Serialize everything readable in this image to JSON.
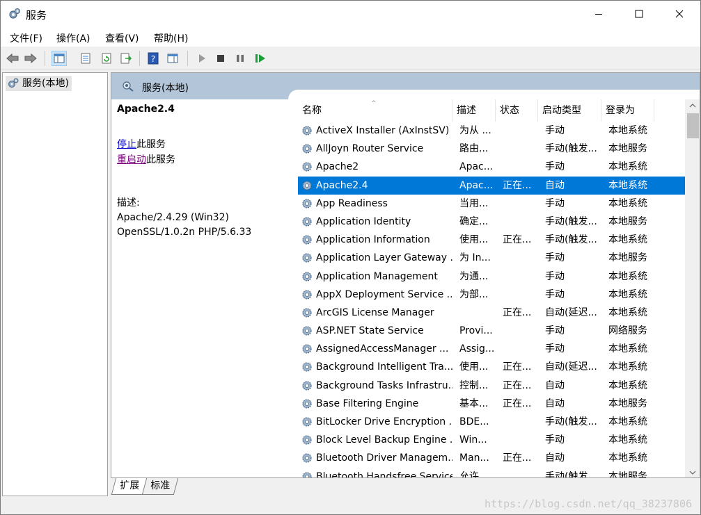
{
  "window": {
    "title": "服务",
    "app_icon": "gears-icon",
    "controls": [
      "minimize",
      "maximize",
      "close"
    ]
  },
  "menu": [
    "文件(F)",
    "操作(A)",
    "查看(V)",
    "帮助(H)"
  ],
  "toolbar": {
    "buttons": [
      "back",
      "forward",
      "show-hide-console-tree",
      "properties",
      "refresh",
      "export-list",
      "help",
      "show-action-pane",
      "start-service",
      "stop-service",
      "pause-service",
      "resume-service"
    ]
  },
  "tree": {
    "items": [
      {
        "label": "服务(本地)",
        "icon": "gears-icon"
      }
    ]
  },
  "pane": {
    "header": "服务(本地)",
    "extended": {
      "service_name": "Apache2.4",
      "stop_link": "停止",
      "stop_suffix": "此服务",
      "restart_link": "重启动",
      "restart_suffix": "此服务",
      "description_label": "描述:",
      "description_text": "Apache/2.4.29 (Win32) OpenSSL/1.0.2n PHP/5.6.33"
    },
    "columns": [
      "名称",
      "描述",
      "状态",
      "启动类型",
      "登录为"
    ],
    "rows": [
      {
        "name": "ActiveX Installer (AxInstSV)",
        "desc": "为从 ...",
        "status": "",
        "start": "手动",
        "logon": "本地系统"
      },
      {
        "name": "AllJoyn Router Service",
        "desc": "路由...",
        "status": "",
        "start": "手动(触发...",
        "logon": "本地服务"
      },
      {
        "name": "Apache2",
        "desc": "Apac...",
        "status": "",
        "start": "手动",
        "logon": "本地系统"
      },
      {
        "name": "Apache2.4",
        "desc": "Apac...",
        "status": "正在...",
        "start": "自动",
        "logon": "本地系统",
        "selected": true
      },
      {
        "name": "App Readiness",
        "desc": "当用...",
        "status": "",
        "start": "手动",
        "logon": "本地系统"
      },
      {
        "name": "Application Identity",
        "desc": "确定...",
        "status": "",
        "start": "手动(触发...",
        "logon": "本地服务"
      },
      {
        "name": "Application Information",
        "desc": "使用...",
        "status": "正在...",
        "start": "手动(触发...",
        "logon": "本地系统"
      },
      {
        "name": "Application Layer Gateway ...",
        "desc": "为 In...",
        "status": "",
        "start": "手动",
        "logon": "本地服务"
      },
      {
        "name": "Application Management",
        "desc": "为通...",
        "status": "",
        "start": "手动",
        "logon": "本地系统"
      },
      {
        "name": "AppX Deployment Service ...",
        "desc": "为部...",
        "status": "",
        "start": "手动",
        "logon": "本地系统"
      },
      {
        "name": "ArcGIS License Manager",
        "desc": "",
        "status": "正在...",
        "start": "自动(延迟...",
        "logon": "本地系统"
      },
      {
        "name": "ASP.NET State Service",
        "desc": "Provi...",
        "status": "",
        "start": "手动",
        "logon": "网络服务"
      },
      {
        "name": "AssignedAccessManager ...",
        "desc": "Assig...",
        "status": "",
        "start": "手动",
        "logon": "本地系统"
      },
      {
        "name": "Background Intelligent Tra...",
        "desc": "使用...",
        "status": "正在...",
        "start": "自动(延迟...",
        "logon": "本地系统"
      },
      {
        "name": "Background Tasks Infrastru...",
        "desc": "控制...",
        "status": "正在...",
        "start": "自动",
        "logon": "本地系统"
      },
      {
        "name": "Base Filtering Engine",
        "desc": "基本...",
        "status": "正在...",
        "start": "自动",
        "logon": "本地服务"
      },
      {
        "name": "BitLocker Drive Encryption ...",
        "desc": "BDE...",
        "status": "",
        "start": "手动(触发...",
        "logon": "本地系统"
      },
      {
        "name": "Block Level Backup Engine ...",
        "desc": "Win...",
        "status": "",
        "start": "手动",
        "logon": "本地系统"
      },
      {
        "name": "Bluetooth Driver Managem...",
        "desc": "Man...",
        "status": "正在...",
        "start": "自动",
        "logon": "本地系统"
      },
      {
        "name": "Bluetooth Handsfree Service",
        "desc": "允许...",
        "status": "",
        "start": "手动(触发...",
        "logon": "本地服务"
      }
    ]
  },
  "tabs": [
    "扩展",
    "标准"
  ],
  "watermark": "https://blog.csdn.net/qq_38237806",
  "colors": {
    "selection": "#0078d7",
    "pane_header": "#b3c6d9",
    "link": "#0000cc",
    "visited_link": "#800080"
  }
}
